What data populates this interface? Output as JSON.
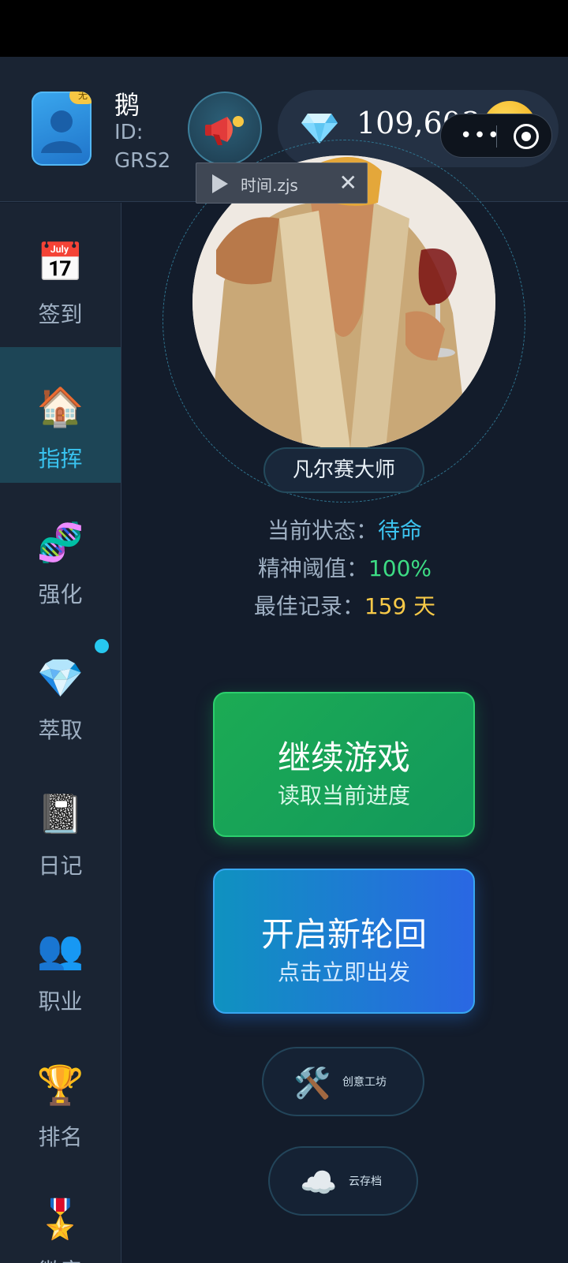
{
  "header": {
    "user_name": "鹅",
    "user_id_label": "ID:",
    "user_id_value": "GRS2",
    "avatar_badge": "无",
    "currency_value": "109,603",
    "add_label": "+",
    "file_name": "时间.zjs",
    "close_label": "✕",
    "capsule_more": "•••"
  },
  "sidebar": {
    "items": [
      {
        "label": "签到",
        "icon": "📅"
      },
      {
        "label": "指挥",
        "icon": "🏠"
      },
      {
        "label": "强化",
        "icon": "🧬"
      },
      {
        "label": "萃取",
        "icon": "💎"
      },
      {
        "label": "日记",
        "icon": "📓"
      },
      {
        "label": "职业",
        "icon": "👥"
      },
      {
        "label": "排名",
        "icon": "🏆"
      },
      {
        "label": "徽章",
        "icon": "🎖️"
      }
    ]
  },
  "main": {
    "title": "凡尔赛大师",
    "status_label": "当前状态：",
    "status_value": "待命",
    "mind_label": "精神阈值：",
    "mind_value": "100%",
    "record_label": "最佳记录：",
    "record_value": "159 天",
    "continue_title": "继续游戏",
    "continue_sub": "读取当前进度",
    "new_title": "开启新轮回",
    "new_sub": "点击立即出发",
    "workshop_icon": "🛠️",
    "workshop_label": "创意工坊",
    "cloud_icon": "☁️",
    "cloud_label": "云存档"
  },
  "colors": {
    "accent": "#39c3ef",
    "green": "#1cab54",
    "blue": "#2a67e3",
    "gold": "#f7c948"
  }
}
